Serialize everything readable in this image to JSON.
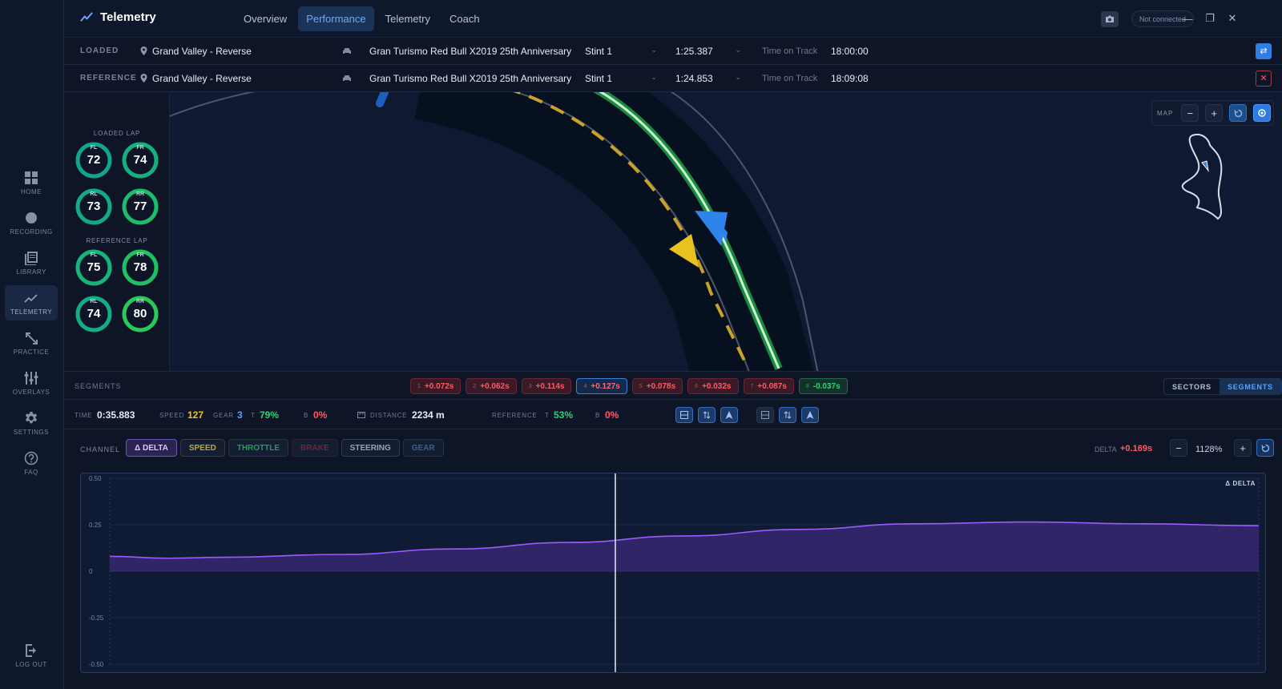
{
  "app": {
    "title": "Telemetry",
    "accent": "#4a93ff"
  },
  "nav": {
    "items": [
      {
        "label": "HOME",
        "icon": "grid-icon"
      },
      {
        "label": "RECORDING",
        "icon": "record-icon"
      },
      {
        "label": "LIBRARY",
        "icon": "library-icon"
      },
      {
        "label": "TELEMETRY",
        "icon": "chart-line-icon",
        "active": true
      },
      {
        "label": "PRACTICE",
        "icon": "practice-icon"
      },
      {
        "label": "OVERLAYS",
        "icon": "sliders-icon"
      },
      {
        "label": "SETTINGS",
        "icon": "gear-icon"
      },
      {
        "label": "FAQ",
        "icon": "help-icon"
      }
    ],
    "logout": "LOG OUT"
  },
  "tabs": [
    "Overview",
    "Performance",
    "Telemetry",
    "Coach"
  ],
  "active_tab": "Performance",
  "connection": "Not connected",
  "loaded": {
    "label": "LOADED",
    "track": "Grand Valley - Reverse",
    "car": "Gran Turismo Red Bull X2019 25th Anniversary",
    "stint": "Stint 1",
    "lap_time": "1:25.387",
    "time_on_track_label": "Time on Track",
    "time_on_track": "18:00:00"
  },
  "reference": {
    "label": "REFERENCE",
    "track": "Grand Valley - Reverse",
    "car": "Gran Turismo Red Bull X2019 25th Anniversary",
    "stint": "Stint 1",
    "lap_time": "1:24.853",
    "time_on_track_label": "Time on Track",
    "time_on_track": "18:09:08"
  },
  "tyres": {
    "loaded_title": "LOADED LAP",
    "reference_title": "REFERENCE LAP",
    "loaded": [
      {
        "pos": "FL",
        "value": "72"
      },
      {
        "pos": "FR",
        "value": "74"
      },
      {
        "pos": "RL",
        "value": "73"
      },
      {
        "pos": "RR",
        "value": "77"
      }
    ],
    "reference": [
      {
        "pos": "FL",
        "value": "75"
      },
      {
        "pos": "FR",
        "value": "78"
      },
      {
        "pos": "RL",
        "value": "74"
      },
      {
        "pos": "RR",
        "value": "80"
      }
    ]
  },
  "map": {
    "label": "MAP",
    "zoom_out": "−",
    "zoom_in": "+"
  },
  "segments": {
    "label": "SEGMENTS",
    "items": [
      {
        "n": "1",
        "delta": "+0.072s",
        "state": "bad"
      },
      {
        "n": "2",
        "delta": "+0.062s",
        "state": "bad"
      },
      {
        "n": "3",
        "delta": "+0.114s",
        "state": "bad"
      },
      {
        "n": "4",
        "delta": "+0.127s",
        "state": "sel"
      },
      {
        "n": "5",
        "delta": "+0.078s",
        "state": "bad"
      },
      {
        "n": "6",
        "delta": "+0.032s",
        "state": "bad"
      },
      {
        "n": "7",
        "delta": "+0.087s",
        "state": "bad"
      },
      {
        "n": "8",
        "delta": "-0.037s",
        "state": "good"
      }
    ],
    "toggle": [
      "SECTORS",
      "SEGMENTS"
    ]
  },
  "readout": {
    "time_label": "TIME",
    "time": "0:35.883",
    "speed_label": "SPEED",
    "speed": "127",
    "gear_label": "GEAR",
    "gear": "3",
    "t_label": "T",
    "throttle": "79%",
    "b_label": "B",
    "brake": "0%",
    "distance_label": "DISTANCE",
    "distance": "2234 m",
    "reference_label": "REFERENCE",
    "ref_t_label": "T",
    "ref_throttle": "53%",
    "ref_b_label": "B",
    "ref_brake": "0%"
  },
  "channels": {
    "label": "CHANNEL",
    "items": [
      {
        "label": "Δ DELTA",
        "color": "#c6a6ff",
        "active": true
      },
      {
        "label": "SPEED",
        "color": "#c9b445"
      },
      {
        "label": "THROTTLE",
        "color": "#2f9a5a"
      },
      {
        "label": "BRAKE",
        "color": "#6b2a35"
      },
      {
        "label": "STEERING",
        "color": "#9aa3b5"
      },
      {
        "label": "GEAR",
        "color": "#3a5f8f"
      }
    ],
    "delta_label": "DELTA",
    "delta_value": "+0.169s",
    "zoom": "1128%",
    "zoom_out": "−",
    "zoom_in": "+"
  },
  "chart_data": {
    "type": "area",
    "title": "",
    "badge": "Δ DELTA",
    "ylim": [
      -0.5,
      0.5
    ],
    "yticks": [
      "0.50",
      "0.25",
      "0",
      "-0.25",
      "-0.50"
    ],
    "x": [
      0,
      0.05,
      0.1,
      0.2,
      0.3,
      0.4,
      0.5,
      0.6,
      0.7,
      0.8,
      0.9,
      1.0
    ],
    "values": [
      0.08,
      0.07,
      0.075,
      0.09,
      0.12,
      0.155,
      0.19,
      0.225,
      0.255,
      0.265,
      0.255,
      0.245
    ],
    "cursor": 0.44,
    "series": [
      {
        "values": [
          0.08,
          0.07,
          0.075,
          0.09,
          0.12,
          0.155,
          0.19,
          0.225,
          0.255,
          0.265,
          0.255,
          0.245
        ],
        "color": "#9a5bff"
      }
    ],
    "grid": true
  }
}
